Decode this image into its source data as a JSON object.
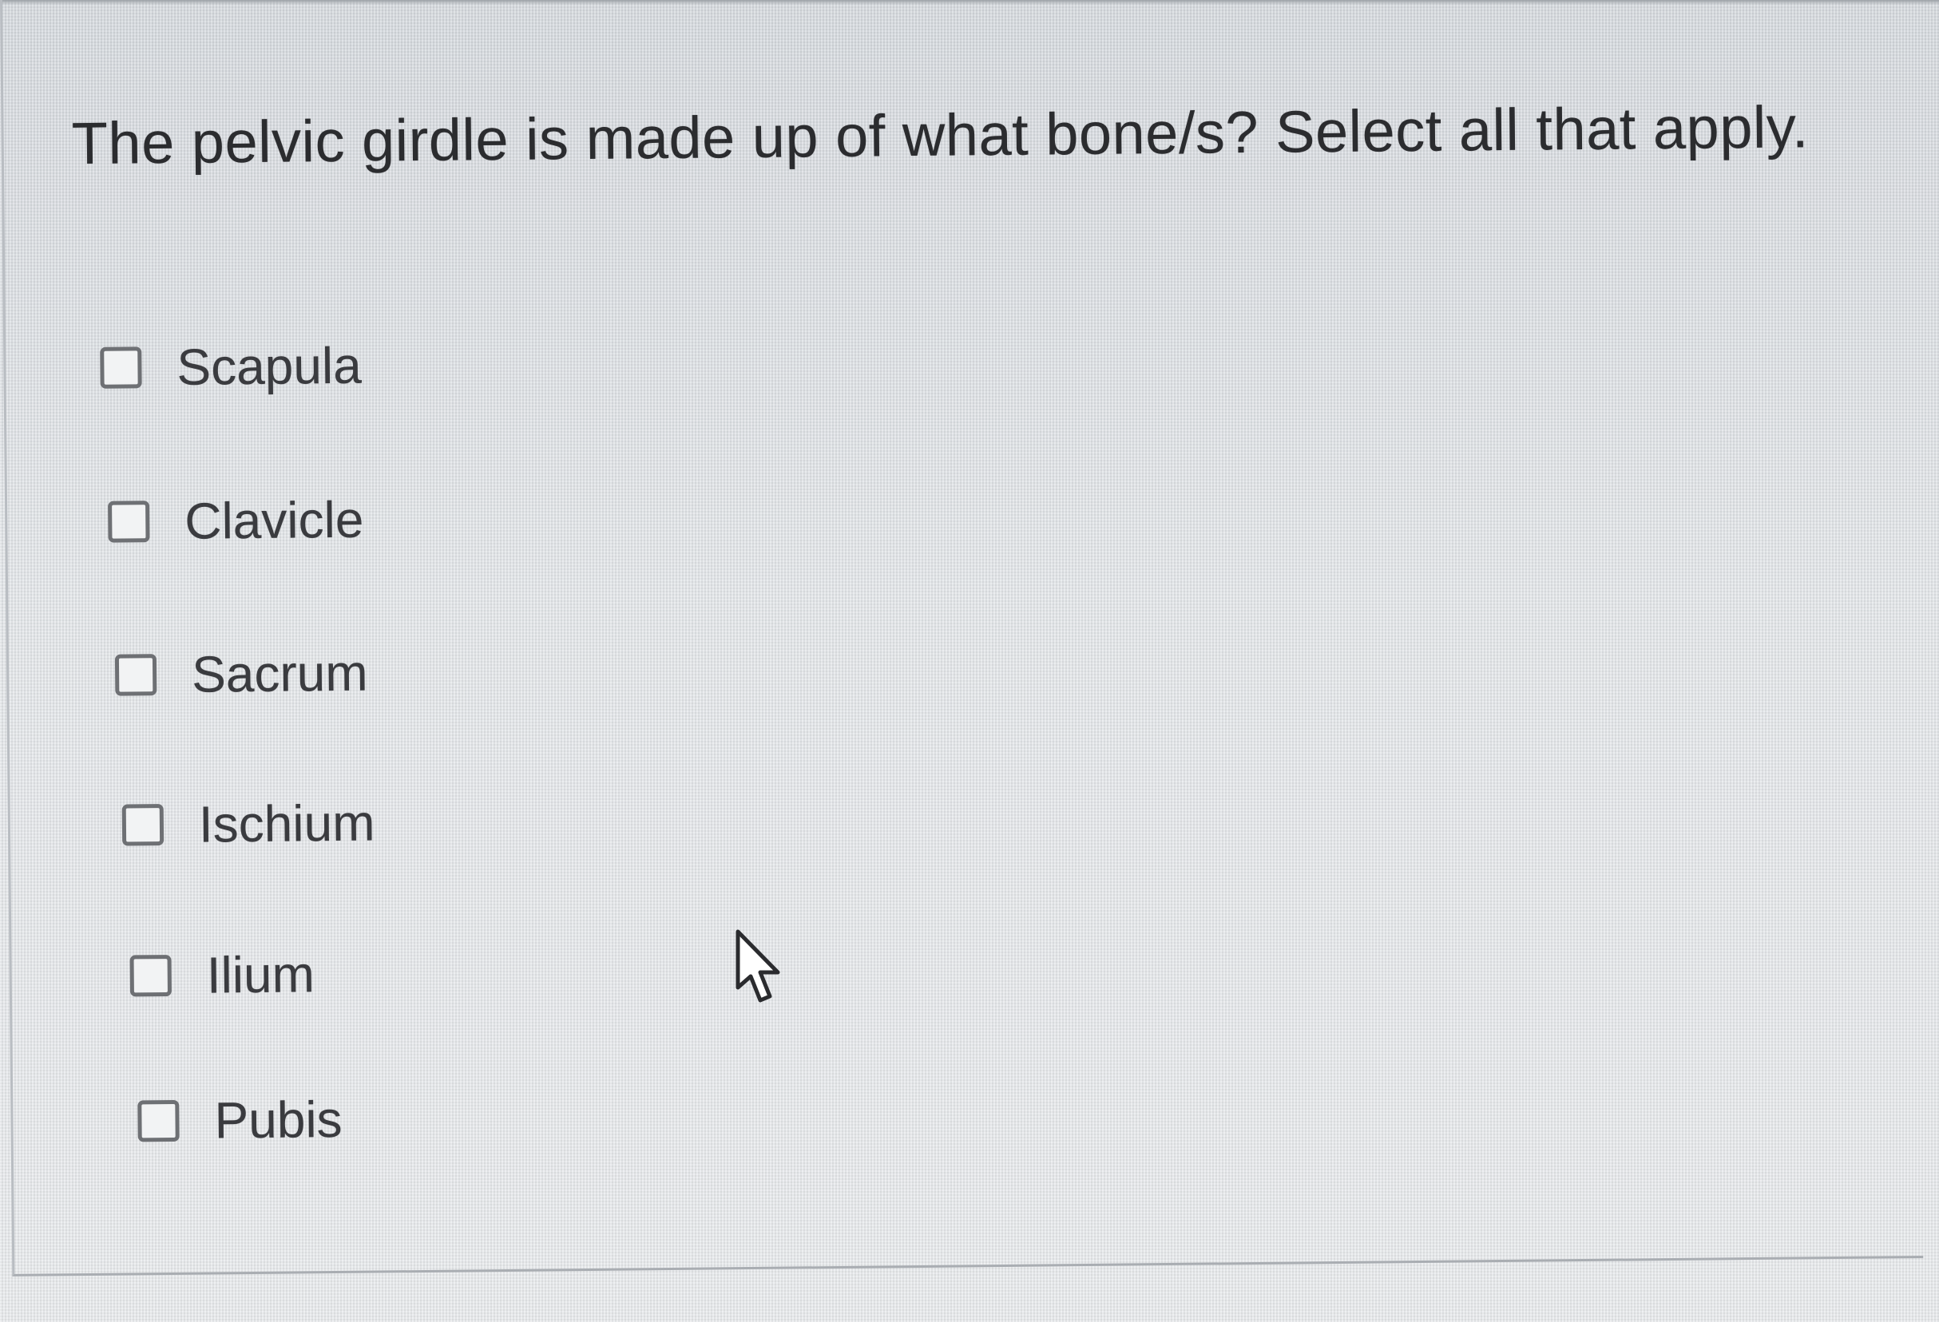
{
  "question": {
    "text": "The pelvic girdle is made up of what bone/s? Select all that apply."
  },
  "options": [
    {
      "label": "Scapula",
      "checked": false
    },
    {
      "label": "Clavicle",
      "checked": false
    },
    {
      "label": "Sacrum",
      "checked": false
    },
    {
      "label": "Ischium",
      "checked": false
    },
    {
      "label": "Ilium",
      "checked": false
    },
    {
      "label": "Pubis",
      "checked": false
    }
  ],
  "icons": {
    "pointer": "mouse-pointer-icon",
    "checkbox": "checkbox-unchecked"
  },
  "colors": {
    "background": "#dfe2e6",
    "text": "#2b2c2f",
    "checkbox_border": "#6e7074"
  }
}
